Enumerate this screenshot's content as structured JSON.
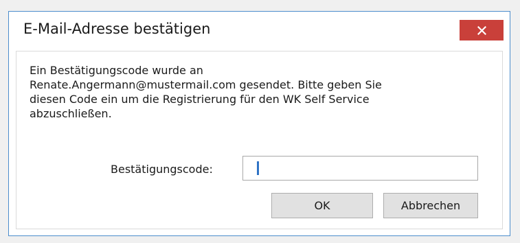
{
  "window": {
    "title": "E-Mail-Adresse bestätigen",
    "close_icon": "close-icon",
    "close_color": "#c9403a",
    "border_color": "#4a8ccc"
  },
  "message": {
    "lines": [
      "Ein Bestätigungscode wurde an",
      "Renate.Angermann@mustermail.com gesendet. Bitte geben Sie",
      "diesen Code ein um die Registrierung für den WK Self Service",
      "abzuschließen."
    ]
  },
  "form": {
    "code_label": "Bestätigungscode:",
    "code_value": ""
  },
  "buttons": {
    "ok_label": "OK",
    "cancel_label": "Abbrechen"
  }
}
